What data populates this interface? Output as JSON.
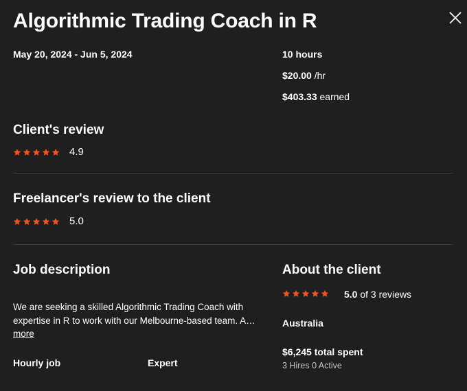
{
  "header": {
    "title": "Algorithmic Trading Coach in R",
    "close_icon": "close-icon"
  },
  "contract": {
    "date_range": "May 20, 2024 - Jun 5, 2024",
    "hours": "10 hours",
    "rate": "$20.00",
    "rate_unit": "/hr",
    "earned_amount": "$403.33",
    "earned_label": "earned"
  },
  "client_review": {
    "heading": "Client's review",
    "rating": "4.9",
    "star_icon": "star-icon",
    "star_color": "#f4511e"
  },
  "freelancer_review": {
    "heading": "Freelancer's review to the client",
    "rating": "5.0"
  },
  "job": {
    "heading": "Job description",
    "description": "We are seeking a skilled Algorithmic Trading Coach with expertise in R to work with our Melbourne-based team. A…",
    "more_label": "more",
    "job_type": "Hourly job",
    "level": "Expert"
  },
  "client": {
    "heading": "About the client",
    "rating": "5.0",
    "reviews_text": "of 3 reviews",
    "location": "Australia",
    "total_spent": "$6,245 total spent",
    "hires": "3 Hires 0 Active"
  },
  "colors": {
    "background": "#1f1f1f",
    "text": "#ffffff",
    "accent_star": "#f4511e",
    "divider": "#3a3a3a"
  }
}
